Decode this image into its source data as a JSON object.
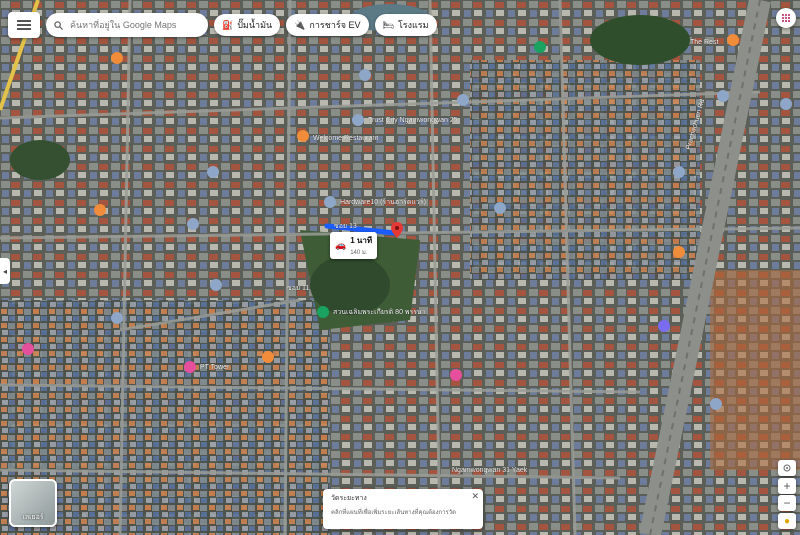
{
  "colors": {
    "route": "#1a5cff",
    "destination_pin": "#e53935",
    "poi_blue": "#8ea6c7",
    "poi_orange": "#f08c3a",
    "poi_green": "#1aa260",
    "poi_pink": "#e64f9c",
    "poi_purple": "#7a6cf0"
  },
  "toolbar": {
    "menu_icon": "hamburger-icon",
    "search_placeholder": "ค้นหาที่อยู่ใน Google Maps",
    "chips": [
      {
        "icon": "gas-station-icon",
        "label": "ปั๊มน้ำมัน"
      },
      {
        "icon": "ev-charger-icon",
        "label": "การชาร์จ EV"
      },
      {
        "icon": "hotel-icon",
        "label": "โรงแรม"
      }
    ]
  },
  "route": {
    "mode_icon": "car-icon",
    "duration": "1 นาที",
    "distance": "140 ม."
  },
  "place_labels": [
    {
      "text": "Hardware10 (ร้านฮาร์ดแวร์)",
      "kind": "poi_blue"
    },
    {
      "text": "สวนเฉลิมพระเกียรติ 80 พรรษา",
      "kind": "poi_green"
    },
    {
      "text": "PT Tower",
      "kind": "poi_pink"
    },
    {
      "text": "Welcome Restaurant",
      "kind": "poi_orange"
    },
    {
      "text": "Trust City Ngamwongwan 25",
      "kind": "poi_blue"
    },
    {
      "text": "ซอย 13",
      "kind": "road"
    },
    {
      "text": "ซอย 11",
      "kind": "road"
    },
    {
      "text": "Prachachuen Rd",
      "kind": "road"
    },
    {
      "text": "Ngamwongwan 31 Yaek",
      "kind": "road"
    },
    {
      "text": "The Rest",
      "kind": "poi_orange"
    }
  ],
  "info_card": {
    "title": "วัดระยะทาง",
    "subtitle": "คลิกที่แผนที่เพื่อเพิ่มระยะเส้นทางที่คุณต้องการวัด"
  },
  "layers_button": {
    "label": "เลเยอร์"
  },
  "controls": {
    "zoom_in": "+",
    "zoom_out": "−"
  }
}
